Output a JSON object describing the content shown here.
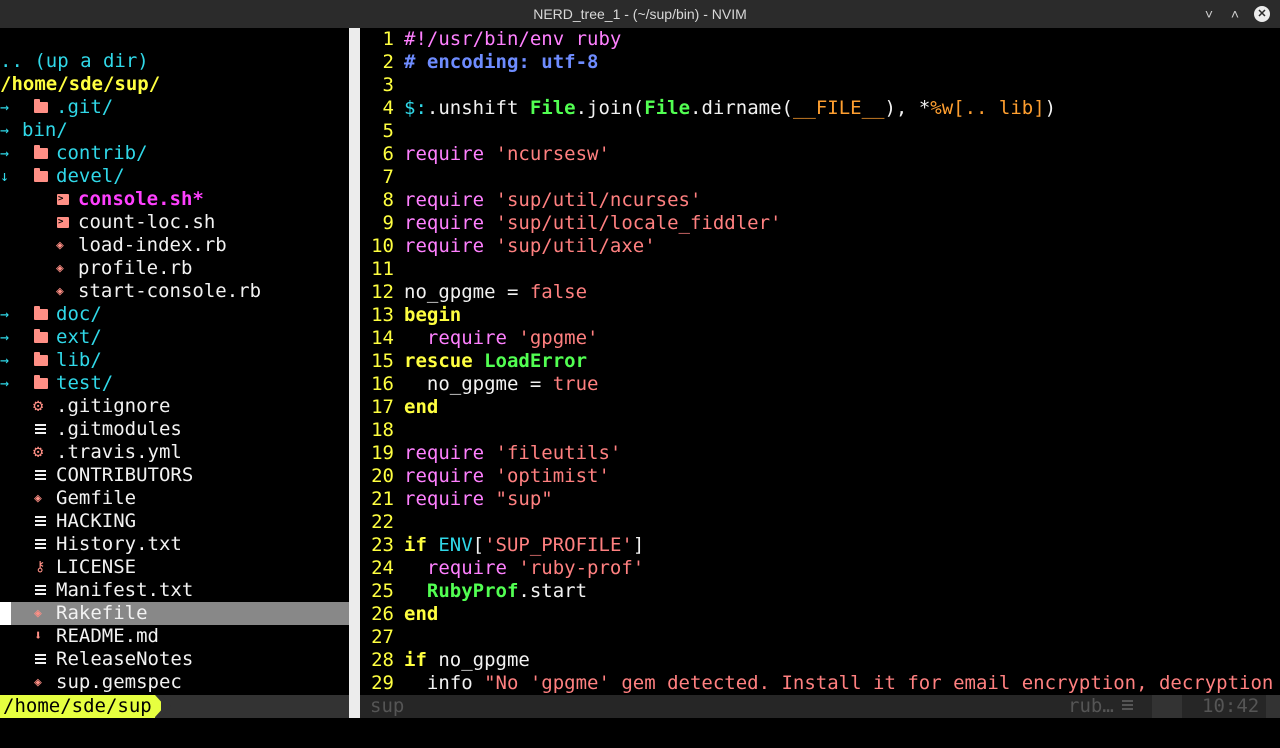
{
  "window": {
    "title": "NERD_tree_1 - (~/sup/bin) - NVIM",
    "min_icon": "minimize-icon",
    "max_icon": "maximize-icon",
    "close_icon": "close-icon"
  },
  "tree": {
    "up_dir": ".. (up a dir)",
    "root": "/home/sde/sup/",
    "items": [
      {
        "name": ".git/",
        "type": "dir",
        "arrow": "→",
        "indent": 0
      },
      {
        "name": "bin/",
        "type": "dir-open-bin",
        "arrow": "→",
        "indent": 0
      },
      {
        "name": "contrib/",
        "type": "dir",
        "arrow": "→",
        "indent": 0
      },
      {
        "name": "devel/",
        "type": "dir",
        "arrow": "↓",
        "indent": 0
      },
      {
        "name": "console.sh*",
        "type": "exec",
        "indent": 1
      },
      {
        "name": "count-loc.sh",
        "type": "sh",
        "indent": 1
      },
      {
        "name": "load-index.rb",
        "type": "ruby",
        "indent": 1
      },
      {
        "name": "profile.rb",
        "type": "ruby",
        "indent": 1
      },
      {
        "name": "start-console.rb",
        "type": "ruby",
        "indent": 1
      },
      {
        "name": "doc/",
        "type": "dir",
        "arrow": "→",
        "indent": 0
      },
      {
        "name": "ext/",
        "type": "dir",
        "arrow": "→",
        "indent": 0
      },
      {
        "name": "lib/",
        "type": "dir",
        "arrow": "→",
        "indent": 0
      },
      {
        "name": "test/",
        "type": "dir",
        "arrow": "→",
        "indent": 0
      },
      {
        "name": ".gitignore",
        "type": "gear",
        "indent": 0
      },
      {
        "name": ".gitmodules",
        "type": "text",
        "indent": 0
      },
      {
        "name": ".travis.yml",
        "type": "gear",
        "indent": 0
      },
      {
        "name": "CONTRIBUTORS",
        "type": "text",
        "indent": 0
      },
      {
        "name": "Gemfile",
        "type": "ruby",
        "indent": 0
      },
      {
        "name": "HACKING",
        "type": "text",
        "indent": 0
      },
      {
        "name": "History.txt",
        "type": "text",
        "indent": 0
      },
      {
        "name": "LICENSE",
        "type": "license",
        "indent": 0
      },
      {
        "name": "Manifest.txt",
        "type": "text",
        "indent": 0
      },
      {
        "name": "Rakefile",
        "type": "ruby",
        "indent": 0,
        "selected": true
      },
      {
        "name": "README.md",
        "type": "markdown",
        "indent": 0
      },
      {
        "name": "ReleaseNotes",
        "type": "text",
        "indent": 0
      },
      {
        "name": "sup.gemspec",
        "type": "ruby",
        "indent": 0
      }
    ],
    "status_path": "/home/sde/sup"
  },
  "editor": {
    "lines": [
      [
        {
          "t": "#!/usr/bin/env ruby",
          "c": "k-pink"
        }
      ],
      [
        {
          "t": "# encoding: utf-8",
          "c": "k-blue"
        }
      ],
      [],
      [
        {
          "t": "$:",
          "c": "k-cyan"
        },
        {
          "t": ".unshift ",
          "c": "k-white"
        },
        {
          "t": "File",
          "c": "k-green"
        },
        {
          "t": ".join(",
          "c": "k-white"
        },
        {
          "t": "File",
          "c": "k-green"
        },
        {
          "t": ".dirname(",
          "c": "k-white"
        },
        {
          "t": "__FILE__",
          "c": "k-orange"
        },
        {
          "t": "), ",
          "c": "k-white"
        },
        {
          "t": "*",
          "c": "k-white"
        },
        {
          "t": "%w[.. lib]",
          "c": "k-orange"
        },
        {
          "t": ")",
          "c": "k-white"
        }
      ],
      [],
      [
        {
          "t": "require ",
          "c": "k-pink"
        },
        {
          "t": "'ncursesw'",
          "c": "k-str"
        }
      ],
      [],
      [
        {
          "t": "require ",
          "c": "k-pink"
        },
        {
          "t": "'sup/util/ncurses'",
          "c": "k-str"
        }
      ],
      [
        {
          "t": "require ",
          "c": "k-pink"
        },
        {
          "t": "'sup/util/locale_fiddler'",
          "c": "k-str"
        }
      ],
      [
        {
          "t": "require ",
          "c": "k-pink"
        },
        {
          "t": "'sup/util/axe'",
          "c": "k-str"
        }
      ],
      [],
      [
        {
          "t": "no_gpgme = ",
          "c": "k-white"
        },
        {
          "t": "false",
          "c": "k-fl"
        }
      ],
      [
        {
          "t": "begin",
          "c": "k-yel"
        }
      ],
      [
        {
          "t": "  require ",
          "c": "k-pink"
        },
        {
          "t": "'gpgme'",
          "c": "k-str"
        }
      ],
      [
        {
          "t": "rescue ",
          "c": "k-yel"
        },
        {
          "t": "LoadError",
          "c": "k-green"
        }
      ],
      [
        {
          "t": "  no_gpgme = ",
          "c": "k-white"
        },
        {
          "t": "true",
          "c": "k-fl"
        }
      ],
      [
        {
          "t": "end",
          "c": "k-yel"
        }
      ],
      [],
      [
        {
          "t": "require ",
          "c": "k-pink"
        },
        {
          "t": "'fileutils'",
          "c": "k-str"
        }
      ],
      [
        {
          "t": "require ",
          "c": "k-pink"
        },
        {
          "t": "'optimist'",
          "c": "k-str"
        }
      ],
      [
        {
          "t": "require ",
          "c": "k-pink"
        },
        {
          "t": "\"sup\"",
          "c": "k-str"
        }
      ],
      [],
      [
        {
          "t": "if ",
          "c": "k-yel"
        },
        {
          "t": "ENV",
          "c": "k-cyan"
        },
        {
          "t": "[",
          "c": "k-white"
        },
        {
          "t": "'SUP_PROFILE'",
          "c": "k-str"
        },
        {
          "t": "]",
          "c": "k-white"
        }
      ],
      [
        {
          "t": "  require ",
          "c": "k-pink"
        },
        {
          "t": "'ruby-prof'",
          "c": "k-str"
        }
      ],
      [
        {
          "t": "  RubyProf",
          "c": "k-green"
        },
        {
          "t": ".start",
          "c": "k-white"
        }
      ],
      [
        {
          "t": "end",
          "c": "k-yel"
        }
      ],
      [],
      [
        {
          "t": "if ",
          "c": "k-yel"
        },
        {
          "t": "no_gpgme",
          "c": "k-white"
        }
      ],
      [
        {
          "t": "  info ",
          "c": "k-white"
        },
        {
          "t": "\"No 'gpgme' gem detected. Install it for email encryption, decryption ",
          "c": "k-str"
        },
        {
          "t": "@",
          "c": "k-blue"
        }
      ]
    ],
    "status": {
      "file": "sup",
      "filetype": "rub…",
      "position": "10:42"
    }
  },
  "colors": {
    "tree_dir": "#30d8e8",
    "root": "#ffff40",
    "modified": "#ff40ff",
    "status_path_bg": "#e6ff40"
  }
}
